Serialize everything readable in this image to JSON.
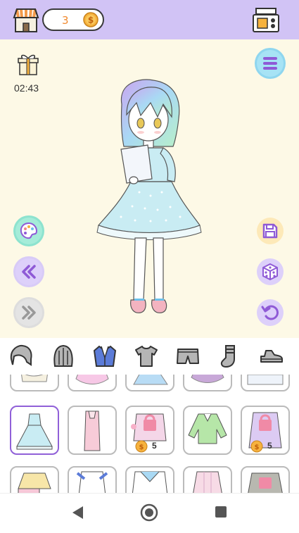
{
  "topbar": {
    "coins": "3",
    "coin_symbol": "$"
  },
  "scene": {
    "timer": "02:43"
  },
  "items": [
    {
      "price": "5",
      "locked": true
    },
    {
      "price": "5",
      "locked": true
    }
  ],
  "colors": {
    "topbar": "#d1c3f5",
    "scene": "#fdf9e6",
    "accent": "#9060d8"
  },
  "icons": [
    "shop-icon",
    "coin-icon",
    "kitchen-icon",
    "gift-icon",
    "menu-icon",
    "palette-icon",
    "save-icon",
    "rewind-icon",
    "dice-icon",
    "forward-icon",
    "undo-icon",
    "hair-icon",
    "back-hair-icon",
    "jacket-icon",
    "shirt-icon",
    "shorts-icon",
    "sock-icon",
    "shoe-icon"
  ]
}
